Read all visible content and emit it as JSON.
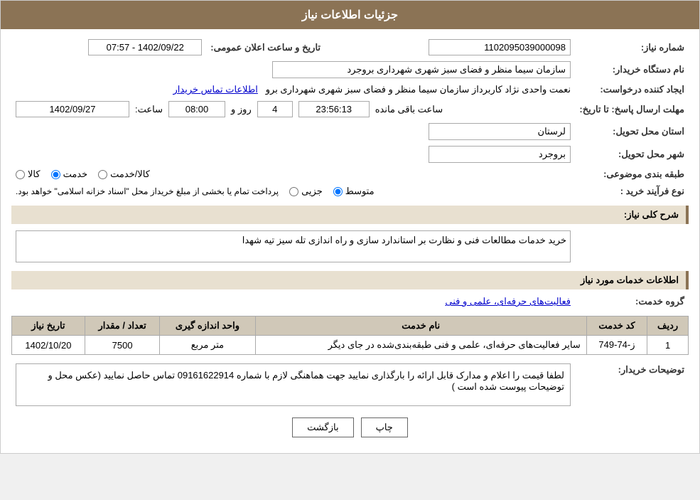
{
  "header": {
    "title": "جزئیات اطلاعات نیاز"
  },
  "fields": {
    "shomara_niaz_label": "شماره نیاز:",
    "shomara_niaz_value": "1102095039000098",
    "nam_dastgah_label": "نام دستگاه خریدار:",
    "nam_dastgah_value": "سازمان سیما منظر و فضای سبز شهری شهرداری بروجرد",
    "eijad_konande_label": "ایجاد کننده درخواست:",
    "eijad_konande_value": "نعمت واحدی نژاد کاربرداز سازمان سیما منظر و فضای سبز شهری شهرداری برو",
    "eijad_konande_link": "اطلاعات تماس خریدار",
    "mohlat_label": "مهلت ارسال پاسخ: تا تاریخ:",
    "mohlat_date": "1402/09/27",
    "mohlat_saat_label": "ساعت:",
    "mohlat_saat": "08:00",
    "mohlat_roz_label": "روز و",
    "mohlat_roz": "4",
    "mohlat_baqi_label": "ساعت باقی مانده",
    "mohlat_baqi": "23:56:13",
    "ostan_label": "استان محل تحویل:",
    "ostan_value": "لرستان",
    "shahr_label": "شهر محل تحویل:",
    "shahr_value": "بروجرد",
    "tabaqe_label": "طبقه بندی موضوعی:",
    "tabaqe_options": [
      "کالا",
      "خدمت",
      "کالا/خدمت"
    ],
    "tabaqe_selected": "خدمت",
    "nofarayand_label": "نوع فرآیند خرید :",
    "nofarayand_options": [
      "جزیی",
      "متوسط"
    ],
    "nofarayand_selected": "متوسط",
    "nofarayand_note": "پرداخت تمام یا بخشی از مبلغ خریداز محل \"اسناد خزانه اسلامی\" خواهد بود.",
    "tarikhe_elan_label": "تاریخ و ساعت اعلان عمومی:",
    "tarikhe_elan_value": "1402/09/22 - 07:57",
    "sharh_label": "شرح کلی نیاز:",
    "sharh_value": "خرید خدمات مطالعات فنی و نظارت بر استاندارد سازی و راه اندازی تله سیز تیه شهدا",
    "khadamat_label": "اطلاعات خدمات مورد نیاز",
    "grouh_label": "گروه خدمت:",
    "grouh_value": "فعالیت‌های حرفه‌ای، علمی و فنی",
    "table": {
      "headers": [
        "ردیف",
        "کد خدمت",
        "نام خدمت",
        "واحد اندازه گیری",
        "تعداد / مقدار",
        "تاریخ نیاز"
      ],
      "rows": [
        {
          "radif": "1",
          "kod": "ز-74-749",
          "nam": "سایر فعالیت‌های حرفه‌ای، علمی و فنی طبقه‌بندی‌شده در جای دیگر",
          "vahed": "متر مربع",
          "tedad": "7500",
          "tarikh": "1402/10/20"
        }
      ]
    },
    "tavzihat_label": "توضیحات خریدار:",
    "tavzihat_value": "لطفا قیمت را اعلام و مدارک قابل ارائه را بارگذاری نمایید جهت هماهنگی لازم با شماره 09161622914 تماس حاصل نمایید\n(عکس محل و توضیحات پیوست شده است )"
  },
  "buttons": {
    "print": "چاپ",
    "back": "بازگشت"
  }
}
